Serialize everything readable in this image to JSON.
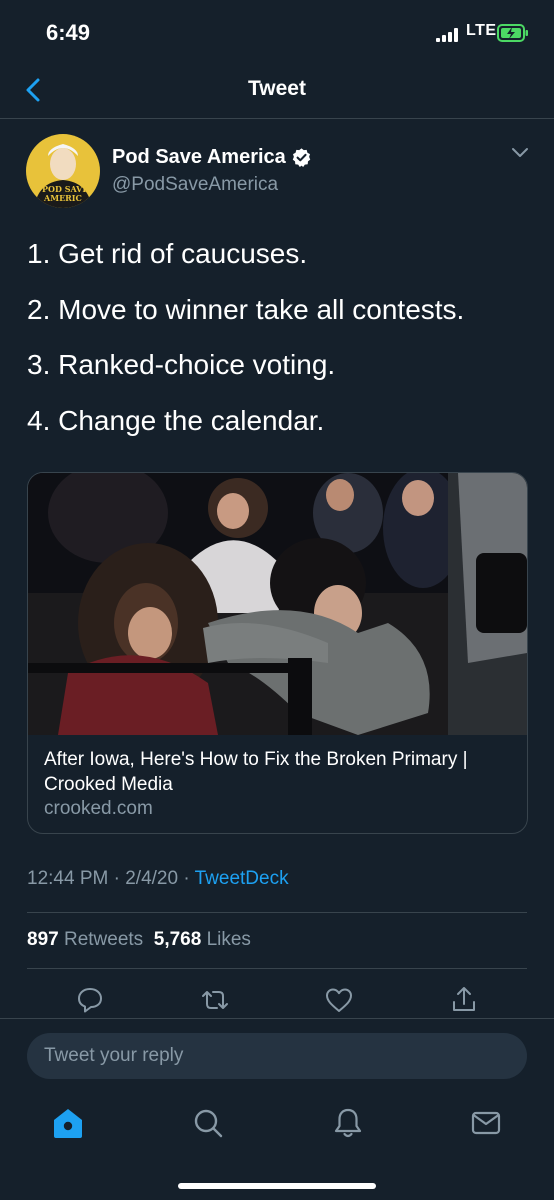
{
  "status_bar": {
    "time": "6:49",
    "network": "LTE",
    "icons": [
      "signal-icon",
      "battery-charging-icon"
    ]
  },
  "nav": {
    "title": "Tweet",
    "back_icon": "chevron-left-icon"
  },
  "author": {
    "name": "Pod Save America",
    "handle": "@PodSaveAmerica",
    "verified": true,
    "avatar_text": [
      "POD SAVE",
      "AMERIC"
    ]
  },
  "tweet": {
    "lines": [
      "1. Get rid of caucuses.",
      "2. Move to winner take all contests.",
      "3. Ranked-choice voting.",
      "4. Change the calendar."
    ]
  },
  "card": {
    "title": "After Iowa, Here's How to Fix the Broken Primary | Crooked Media",
    "domain": "crooked.com"
  },
  "meta": {
    "time": "12:44 PM",
    "date": "2/4/20",
    "source": "TweetDeck",
    "separator": " · "
  },
  "stats": {
    "retweets_count": "897",
    "retweets_label": "Retweets",
    "likes_count": "5,768",
    "likes_label": "Likes"
  },
  "actions": [
    "reply-icon",
    "retweet-icon",
    "like-icon",
    "share-icon"
  ],
  "reply": {
    "placeholder": "Tweet your reply"
  },
  "tabs": [
    "home-icon",
    "search-icon",
    "notifications-icon",
    "messages-icon"
  ],
  "colors": {
    "background": "#15202b",
    "accent": "#1da1f2",
    "secondary_text": "#8899a6",
    "divider": "#38444d"
  }
}
